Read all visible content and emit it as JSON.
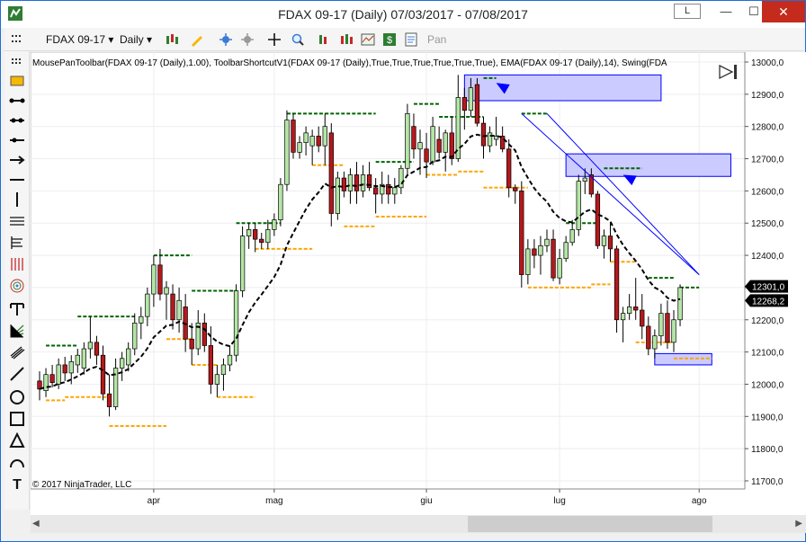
{
  "window": {
    "title": "FDAX 09-17 (Daily)  07/03/2017 - 07/08/2017",
    "layout_button": "L",
    "minimize": "—",
    "maximize": "☐",
    "close": "✕"
  },
  "toolbar": {
    "instrument": "FDAX 09-17",
    "interval": "Daily",
    "pan_label": "Pan"
  },
  "chart_header": {
    "indicators_text": "MousePanToolbar(FDAX 09-17 (Daily),1.00), ToolbarShortcutV1(FDAX 09-17 (Daily),True,True,True,True,True,True), EMA(FDAX 09-17 (Daily),14), Swing(FDA",
    "copyright": "© 2017 NinjaTrader, LLC"
  },
  "colors": {
    "up_candle": "#b4e6a6",
    "down_candle": "#b4191c",
    "ema": "#000000",
    "swing_high": "#006400",
    "swing_low": "#ffa500",
    "zone_fill": "#c8c8ff",
    "zone_border": "#0000ff",
    "arrow": "#0000ff",
    "price_tag": "#000000"
  },
  "chart_data": {
    "type": "candlestick",
    "instrument": "FDAX 09-17",
    "interval": "Daily",
    "y_ticks": [
      11700,
      11800,
      11900,
      12000,
      12100,
      12200,
      12300,
      12400,
      12500,
      12600,
      12700,
      12800,
      12900,
      13000
    ],
    "y_tick_labels": [
      "11700,0",
      "11800,0",
      "11900,0",
      "12000,0",
      "12100,0",
      "12200,0",
      "12300,0",
      "12400,0",
      "12500,0",
      "12600,0",
      "12700,0",
      "12800,0",
      "12900,0",
      "13000,0"
    ],
    "ylim": [
      11680,
      13015
    ],
    "x_labels": [
      {
        "index": 18,
        "label": "apr"
      },
      {
        "index": 37,
        "label": "mag"
      },
      {
        "index": 61,
        "label": "giu"
      },
      {
        "index": 82,
        "label": "lug"
      },
      {
        "index": 104,
        "label": "ago"
      }
    ],
    "candles": [
      {
        "o": 12010,
        "h": 12040,
        "l": 11950,
        "c": 11985
      },
      {
        "o": 11980,
        "h": 12050,
        "l": 11960,
        "c": 12030
      },
      {
        "o": 12030,
        "h": 12060,
        "l": 11990,
        "c": 12005
      },
      {
        "o": 12000,
        "h": 12080,
        "l": 11985,
        "c": 12060
      },
      {
        "o": 12060,
        "h": 12085,
        "l": 12010,
        "c": 12035
      },
      {
        "o": 12035,
        "h": 12090,
        "l": 12000,
        "c": 12070
      },
      {
        "o": 12060,
        "h": 12110,
        "l": 12035,
        "c": 12090
      },
      {
        "o": 12050,
        "h": 12130,
        "l": 12030,
        "c": 12110
      },
      {
        "o": 12110,
        "h": 12210,
        "l": 12080,
        "c": 12130
      },
      {
        "o": 12130,
        "h": 12150,
        "l": 12060,
        "c": 12090
      },
      {
        "o": 12090,
        "h": 12120,
        "l": 11950,
        "c": 11970
      },
      {
        "o": 11970,
        "h": 12030,
        "l": 11900,
        "c": 11930
      },
      {
        "o": 11930,
        "h": 12080,
        "l": 11920,
        "c": 12050
      },
      {
        "o": 12050,
        "h": 12100,
        "l": 12010,
        "c": 12080
      },
      {
        "o": 12060,
        "h": 12130,
        "l": 12040,
        "c": 12110
      },
      {
        "o": 12110,
        "h": 12220,
        "l": 12090,
        "c": 12190
      },
      {
        "o": 12190,
        "h": 12240,
        "l": 12140,
        "c": 12210
      },
      {
        "o": 12210,
        "h": 12300,
        "l": 12180,
        "c": 12280
      },
      {
        "o": 12280,
        "h": 12400,
        "l": 12240,
        "c": 12370
      },
      {
        "o": 12370,
        "h": 12420,
        "l": 12260,
        "c": 12280
      },
      {
        "o": 12280,
        "h": 12320,
        "l": 12200,
        "c": 12300
      },
      {
        "o": 12280,
        "h": 12310,
        "l": 12170,
        "c": 12200
      },
      {
        "o": 12200,
        "h": 12300,
        "l": 12160,
        "c": 12260
      },
      {
        "o": 12240,
        "h": 12280,
        "l": 12100,
        "c": 12140
      },
      {
        "o": 12140,
        "h": 12190,
        "l": 12060,
        "c": 12110
      },
      {
        "o": 12110,
        "h": 12230,
        "l": 12090,
        "c": 12190
      },
      {
        "o": 12190,
        "h": 12220,
        "l": 12100,
        "c": 12120
      },
      {
        "o": 12120,
        "h": 12180,
        "l": 11970,
        "c": 12000
      },
      {
        "o": 12000,
        "h": 12060,
        "l": 11960,
        "c": 12030
      },
      {
        "o": 12030,
        "h": 12080,
        "l": 11980,
        "c": 12060
      },
      {
        "o": 12060,
        "h": 12120,
        "l": 12040,
        "c": 12090
      },
      {
        "o": 12090,
        "h": 12310,
        "l": 12070,
        "c": 12290
      },
      {
        "o": 12290,
        "h": 12490,
        "l": 12270,
        "c": 12460
      },
      {
        "o": 12460,
        "h": 12500,
        "l": 12420,
        "c": 12480
      },
      {
        "o": 12480,
        "h": 12500,
        "l": 12410,
        "c": 12450
      },
      {
        "o": 12450,
        "h": 12470,
        "l": 12420,
        "c": 12440
      },
      {
        "o": 12440,
        "h": 12510,
        "l": 12420,
        "c": 12480
      },
      {
        "o": 12480,
        "h": 12530,
        "l": 12460,
        "c": 12510
      },
      {
        "o": 12510,
        "h": 12640,
        "l": 12490,
        "c": 12620
      },
      {
        "o": 12620,
        "h": 12850,
        "l": 12600,
        "c": 12820
      },
      {
        "o": 12820,
        "h": 12840,
        "l": 12700,
        "c": 12720
      },
      {
        "o": 12720,
        "h": 12770,
        "l": 12700,
        "c": 12750
      },
      {
        "o": 12750,
        "h": 12800,
        "l": 12710,
        "c": 12780
      },
      {
        "o": 12740,
        "h": 12790,
        "l": 12680,
        "c": 12770
      },
      {
        "o": 12770,
        "h": 12800,
        "l": 12720,
        "c": 12740
      },
      {
        "o": 12740,
        "h": 12840,
        "l": 12680,
        "c": 12800
      },
      {
        "o": 12780,
        "h": 12810,
        "l": 12490,
        "c": 12530
      },
      {
        "o": 12530,
        "h": 12660,
        "l": 12510,
        "c": 12640
      },
      {
        "o": 12640,
        "h": 12660,
        "l": 12580,
        "c": 12600
      },
      {
        "o": 12600,
        "h": 12670,
        "l": 12560,
        "c": 12650
      },
      {
        "o": 12650,
        "h": 12690,
        "l": 12560,
        "c": 12600
      },
      {
        "o": 12600,
        "h": 12680,
        "l": 12580,
        "c": 12650
      },
      {
        "o": 12650,
        "h": 12690,
        "l": 12600,
        "c": 12610
      },
      {
        "o": 12610,
        "h": 12640,
        "l": 12530,
        "c": 12590
      },
      {
        "o": 12590,
        "h": 12660,
        "l": 12560,
        "c": 12620
      },
      {
        "o": 12620,
        "h": 12650,
        "l": 12560,
        "c": 12590
      },
      {
        "o": 12590,
        "h": 12640,
        "l": 12560,
        "c": 12610
      },
      {
        "o": 12610,
        "h": 12680,
        "l": 12590,
        "c": 12670
      },
      {
        "o": 12670,
        "h": 12870,
        "l": 12650,
        "c": 12840
      },
      {
        "o": 12800,
        "h": 12840,
        "l": 12700,
        "c": 12730
      },
      {
        "o": 12730,
        "h": 12790,
        "l": 12650,
        "c": 12750
      },
      {
        "o": 12730,
        "h": 12780,
        "l": 12640,
        "c": 12690
      },
      {
        "o": 12690,
        "h": 12830,
        "l": 12680,
        "c": 12800
      },
      {
        "o": 12760,
        "h": 12800,
        "l": 12700,
        "c": 12720
      },
      {
        "o": 12720,
        "h": 12790,
        "l": 12660,
        "c": 12780
      },
      {
        "o": 12780,
        "h": 12830,
        "l": 12680,
        "c": 12700
      },
      {
        "o": 12700,
        "h": 12960,
        "l": 12690,
        "c": 12890
      },
      {
        "o": 12890,
        "h": 12920,
        "l": 12790,
        "c": 12850
      },
      {
        "o": 12850,
        "h": 12950,
        "l": 12830,
        "c": 12920
      },
      {
        "o": 12930,
        "h": 12950,
        "l": 12800,
        "c": 12810
      },
      {
        "o": 12810,
        "h": 12830,
        "l": 12700,
        "c": 12740
      },
      {
        "o": 12740,
        "h": 12800,
        "l": 12720,
        "c": 12780
      },
      {
        "o": 12760,
        "h": 12830,
        "l": 12740,
        "c": 12770
      },
      {
        "o": 12770,
        "h": 12800,
        "l": 12720,
        "c": 12730
      },
      {
        "o": 12730,
        "h": 12760,
        "l": 12580,
        "c": 12610
      },
      {
        "o": 12610,
        "h": 12620,
        "l": 12560,
        "c": 12600
      },
      {
        "o": 12600,
        "h": 12630,
        "l": 12300,
        "c": 12340
      },
      {
        "o": 12340,
        "h": 12450,
        "l": 12310,
        "c": 12420
      },
      {
        "o": 12420,
        "h": 12450,
        "l": 12360,
        "c": 12400
      },
      {
        "o": 12400,
        "h": 12460,
        "l": 12340,
        "c": 12430
      },
      {
        "o": 12430,
        "h": 12480,
        "l": 12410,
        "c": 12450
      },
      {
        "o": 12450,
        "h": 12480,
        "l": 12320,
        "c": 12330
      },
      {
        "o": 12330,
        "h": 12420,
        "l": 12310,
        "c": 12390
      },
      {
        "o": 12390,
        "h": 12460,
        "l": 12380,
        "c": 12440
      },
      {
        "o": 12440,
        "h": 12510,
        "l": 12430,
        "c": 12480
      },
      {
        "o": 12480,
        "h": 12650,
        "l": 12460,
        "c": 12630
      },
      {
        "o": 12630,
        "h": 12670,
        "l": 12590,
        "c": 12640
      },
      {
        "o": 12650,
        "h": 12670,
        "l": 12580,
        "c": 12590
      },
      {
        "o": 12590,
        "h": 12600,
        "l": 12420,
        "c": 12430
      },
      {
        "o": 12430,
        "h": 12480,
        "l": 12390,
        "c": 12460
      },
      {
        "o": 12460,
        "h": 12500,
        "l": 12380,
        "c": 12420
      },
      {
        "o": 12420,
        "h": 12430,
        "l": 12160,
        "c": 12200
      },
      {
        "o": 12200,
        "h": 12240,
        "l": 12130,
        "c": 12220
      },
      {
        "o": 12220,
        "h": 12280,
        "l": 12200,
        "c": 12240
      },
      {
        "o": 12240,
        "h": 12330,
        "l": 12200,
        "c": 12230
      },
      {
        "o": 12230,
        "h": 12280,
        "l": 12140,
        "c": 12180
      },
      {
        "o": 12180,
        "h": 12210,
        "l": 12090,
        "c": 12110
      },
      {
        "o": 12110,
        "h": 12170,
        "l": 12080,
        "c": 12150
      },
      {
        "o": 12150,
        "h": 12250,
        "l": 12120,
        "c": 12220
      },
      {
        "o": 12220,
        "h": 12260,
        "l": 12110,
        "c": 12130
      },
      {
        "o": 12130,
        "h": 12230,
        "l": 12100,
        "c": 12200
      },
      {
        "o": 12200,
        "h": 12310,
        "l": 12180,
        "c": 12300
      }
    ],
    "ema_last": 12268.2,
    "last_price": 12301.0,
    "price_tags": [
      "12301,0",
      "12268,2"
    ],
    "swing_highs": [
      {
        "start": 1,
        "end": 6,
        "price": 12120
      },
      {
        "start": 6,
        "end": 15,
        "price": 12210
      },
      {
        "start": 18,
        "end": 24,
        "price": 12400
      },
      {
        "start": 24,
        "end": 31,
        "price": 12290
      },
      {
        "start": 31,
        "end": 38,
        "price": 12500
      },
      {
        "start": 39,
        "end": 45,
        "price": 12840
      },
      {
        "start": 45,
        "end": 53,
        "price": 12840
      },
      {
        "start": 53,
        "end": 59,
        "price": 12690
      },
      {
        "start": 59,
        "end": 63,
        "price": 12870
      },
      {
        "start": 63,
        "end": 70,
        "price": 12830
      },
      {
        "start": 70,
        "end": 72,
        "price": 12950
      },
      {
        "start": 76,
        "end": 80,
        "price": 12840
      },
      {
        "start": 83,
        "end": 88,
        "price": 12500
      },
      {
        "start": 89,
        "end": 95,
        "price": 12670
      },
      {
        "start": 96,
        "end": 100,
        "price": 12330
      },
      {
        "start": 101,
        "end": 104,
        "price": 12300
      }
    ],
    "swing_lows": [
      {
        "start": 1,
        "end": 4,
        "price": 11950
      },
      {
        "start": 4,
        "end": 11,
        "price": 11960
      },
      {
        "start": 11,
        "end": 20,
        "price": 11870
      },
      {
        "start": 20,
        "end": 24,
        "price": 12140
      },
      {
        "start": 24,
        "end": 28,
        "price": 12060
      },
      {
        "start": 28,
        "end": 34,
        "price": 11960
      },
      {
        "start": 34,
        "end": 43,
        "price": 12420
      },
      {
        "start": 43,
        "end": 48,
        "price": 12680
      },
      {
        "start": 48,
        "end": 53,
        "price": 12490
      },
      {
        "start": 53,
        "end": 61,
        "price": 12520
      },
      {
        "start": 61,
        "end": 66,
        "price": 12650
      },
      {
        "start": 66,
        "end": 70,
        "price": 12660
      },
      {
        "start": 70,
        "end": 77,
        "price": 12610
      },
      {
        "start": 77,
        "end": 87,
        "price": 12300
      },
      {
        "start": 87,
        "end": 90,
        "price": 12310
      },
      {
        "start": 90,
        "end": 94,
        "price": 12380
      },
      {
        "start": 94,
        "end": 100,
        "price": 12130
      },
      {
        "start": 100,
        "end": 106,
        "price": 12080
      }
    ],
    "zones": [
      {
        "start": 67,
        "end": 98,
        "top": 12960,
        "bottom": 12880
      },
      {
        "start": 83,
        "end": 109,
        "top": 12715,
        "bottom": 12645
      },
      {
        "start": 97,
        "end": 106,
        "top": 12095,
        "bottom": 12060
      }
    ],
    "trend_lines": [
      {
        "from": [
          76,
          12840
        ],
        "to": [
          104,
          12340
        ]
      },
      {
        "from": [
          80,
          12840
        ],
        "to": [
          104,
          12340
        ]
      }
    ],
    "arrows": [
      {
        "at": [
          72,
          12935
        ],
        "from": [
          76,
          12890
        ]
      },
      {
        "at": [
          92,
          12650
        ],
        "from": [
          95,
          12620
        ]
      }
    ]
  }
}
